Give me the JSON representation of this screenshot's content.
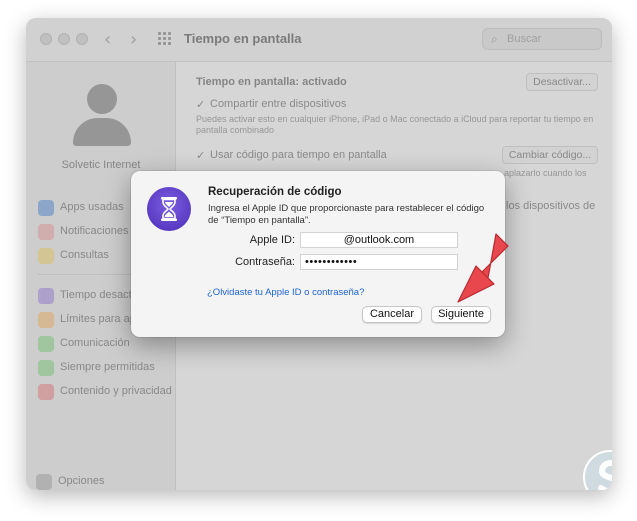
{
  "window": {
    "title": "Tiempo en pantalla",
    "search_placeholder": "Buscar",
    "nav_back_icon": "‹",
    "nav_forward_icon": "›"
  },
  "sidebar": {
    "user_name": "Solvetic Internet",
    "items": [
      {
        "label": "Apps usadas",
        "icon": "bar-chart-icon",
        "color": "#8fb0d8"
      },
      {
        "label": "Notificaciones",
        "icon": "bell-icon",
        "color": "#e3b9b9"
      },
      {
        "label": "Consultas",
        "icon": "phone-pickup-icon",
        "color": "#e6d69a"
      },
      {
        "label": "Tiempo desactivado",
        "icon": "moon-icon",
        "color": "#b8a9dc"
      },
      {
        "label": "Límites para apps",
        "icon": "hourglass-icon",
        "color": "#e8c59a"
      },
      {
        "label": "Comunicación",
        "icon": "person-bubble-icon",
        "color": "#a8d6a8"
      },
      {
        "label": "Siempre permitidas",
        "icon": "checkmark-icon",
        "color": "#a8d6a8"
      },
      {
        "label": "Contenido y privacidad",
        "icon": "no-entry-icon",
        "color": "#e2a8a8"
      }
    ],
    "options_label": "Opciones"
  },
  "content": {
    "status_label": "Tiempo en pantalla: activado",
    "deactivate_button": "Desactivar...",
    "share_checkbox_label": "Compartir entre dispositivos",
    "share_desc_line1": "Puedes activar esto en cualquier iPhone, iPad o Mac conectado a iCloud para reportar tu tiempo en",
    "share_desc_line2": "pantalla combinado",
    "code_checkbox_label": "Usar código para tiempo en pantalla",
    "change_code_button": "Cambiar código...",
    "partial_right_1": "aplazarlo cuando los",
    "partial_right_2": "los dispositivos de"
  },
  "dialog": {
    "title": "Recuperación de código",
    "description": "Ingresa el Apple ID que proporcionaste para restablecer el código de “Tiempo en pantalla”.",
    "apple_id_label": "Apple ID:",
    "apple_id_value": "@outlook.com",
    "password_label": "Contraseña:",
    "password_value": "••••••••••••",
    "forgot_link": "¿Olvidaste tu Apple ID o contraseña?",
    "cancel_button": "Cancelar",
    "next_button": "Siguiente"
  },
  "colors": {
    "accent_link": "#1d63d6",
    "arrow": "#e8474e",
    "dialog_icon": "#5a3bc4"
  }
}
